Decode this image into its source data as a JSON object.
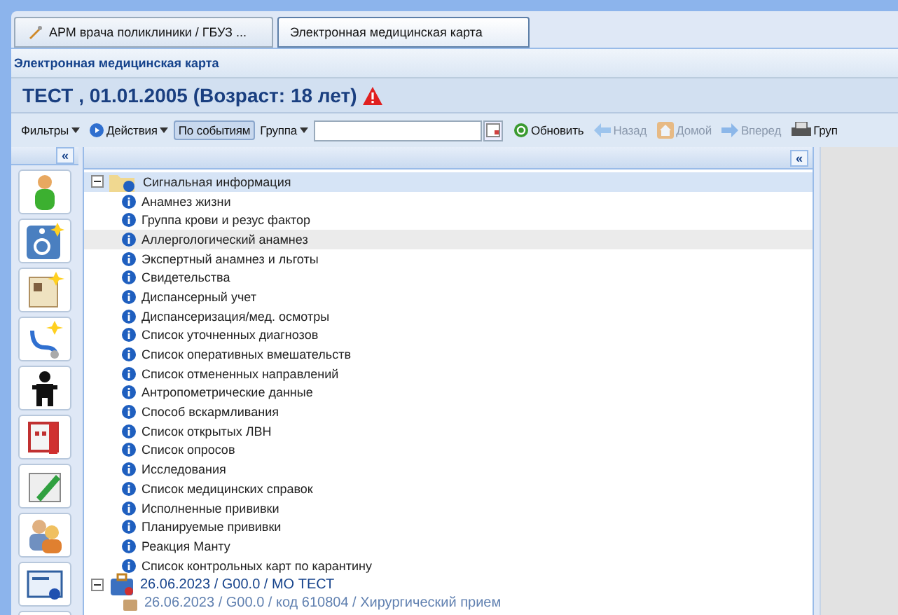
{
  "window_tabs": [
    {
      "label": "АРМ врача поликлиники / ГБУЗ ...",
      "selected": false
    },
    {
      "label": "Электронная медицинская карта",
      "selected": true
    }
  ],
  "panel_title": "Электронная медицинская карта",
  "patient": {
    "title": "ТЕСТ , 01.01.2005 (Возраст: 18 лет)",
    "warning": true
  },
  "toolbar": [
    {
      "kind": "menu",
      "label": "Фильтры",
      "disabled": false,
      "selected": false
    },
    {
      "kind": "actions",
      "label": "Действия",
      "disabled": false,
      "selected": false
    },
    {
      "kind": "toggle",
      "label": "По событиям",
      "disabled": false,
      "selected": true
    },
    {
      "kind": "menu",
      "label": "Группа",
      "disabled": false,
      "selected": false
    }
  ],
  "toolbar_right": [
    {
      "kind": "refresh",
      "label": "Обновить",
      "disabled": false,
      "selected": false
    },
    {
      "kind": "back",
      "label": "Назад",
      "disabled": true,
      "selected": false
    },
    {
      "kind": "home",
      "label": "Домой",
      "disabled": true,
      "selected": false
    },
    {
      "kind": "forward",
      "label": "Вперед",
      "disabled": true,
      "selected": false
    },
    {
      "kind": "print",
      "label": "Груп",
      "disabled": false,
      "selected": false
    }
  ],
  "collapse_glyph": "«",
  "tree": [
    {
      "kind": "folder",
      "label": "Сигнальная информация",
      "expanded": true,
      "children": [
        {
          "label": "Анамнез жизни",
          "selected": false
        },
        {
          "label": "Группа крови и резус фактор",
          "selected": false
        },
        {
          "label": "Аллергологический анамнез",
          "selected": true
        },
        {
          "label": "Экспертный анамнез и льготы",
          "selected": false
        },
        {
          "label": "Свидетельства",
          "selected": false
        },
        {
          "label": "Диспансерный учет",
          "selected": false
        },
        {
          "label": "Диспансеризация/мед. осмотры",
          "selected": false
        },
        {
          "label": "Список уточненных диагнозов",
          "selected": false
        },
        {
          "label": "Список оперативных вмешательств",
          "selected": false
        },
        {
          "label": "Список отмененных направлений",
          "selected": false
        },
        {
          "label": "Антропометрические данные",
          "selected": false
        },
        {
          "label": "Способ вскармливания",
          "selected": false
        },
        {
          "label": "Список открытых ЛВН",
          "selected": false
        },
        {
          "label": "Список опросов",
          "selected": false
        },
        {
          "label": "Исследования",
          "selected": false
        },
        {
          "label": "Список медицинских справок",
          "selected": false
        },
        {
          "label": "Исполненные прививки",
          "selected": false
        },
        {
          "label": "Планируемые прививки",
          "selected": false
        },
        {
          "label": "Реакция Манту",
          "selected": false
        },
        {
          "label": "Список контрольных карт по карантину",
          "selected": false
        }
      ]
    },
    {
      "kind": "event",
      "label": "26.06.2023  /  G00.0  /  МО ТЕСТ",
      "expanded": true,
      "children": [
        {
          "label": "26.06.2023  /  G00.0  /  код 610804  /  Хирургический прием",
          "selected": false
        }
      ]
    }
  ]
}
